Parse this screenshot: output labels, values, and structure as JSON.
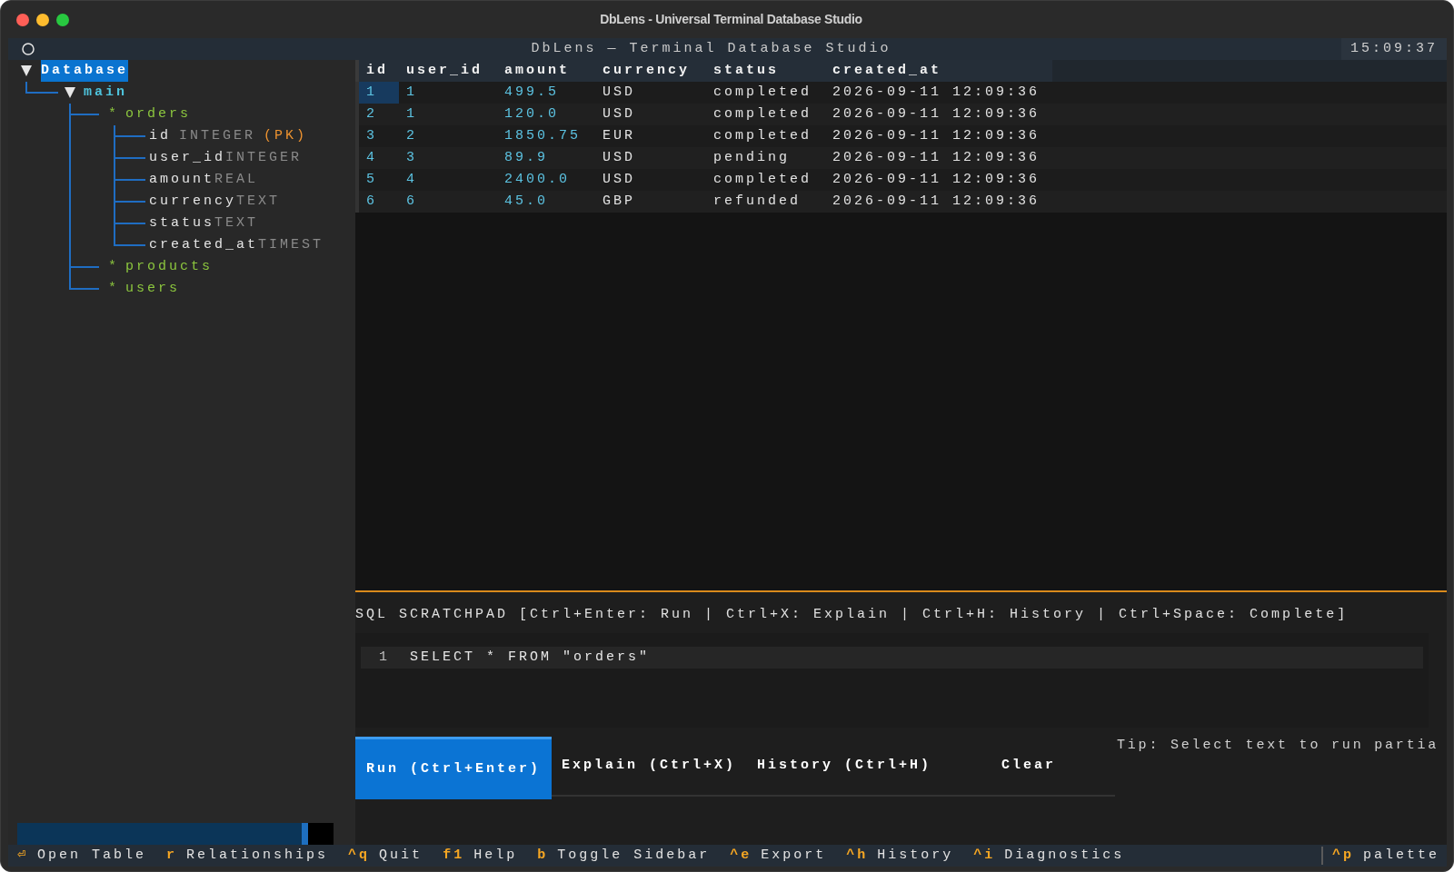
{
  "window": {
    "title": "DbLens - Universal Terminal Database Studio"
  },
  "header": {
    "title": "DbLens — Terminal Database Studio",
    "clock": "15:09:37"
  },
  "sidebar": {
    "tree": [
      {
        "kind": "database",
        "label": "Database",
        "expanded": true,
        "selected": true,
        "children": [
          {
            "kind": "schema",
            "label": "main",
            "expanded": true,
            "selected": false,
            "children": [
              {
                "kind": "table",
                "marker": "*",
                "label": "orders",
                "selected": false,
                "children": [
                  {
                    "kind": "column",
                    "label": "id",
                    "type": "INTEGER",
                    "badge": "(PK)",
                    "selected": false
                  },
                  {
                    "kind": "column",
                    "label": "user_id",
                    "type": "INTEGER",
                    "selected": false
                  },
                  {
                    "kind": "column",
                    "label": "amount",
                    "type": "REAL",
                    "selected": false
                  },
                  {
                    "kind": "column",
                    "label": "currency",
                    "type": "TEXT",
                    "selected": false
                  },
                  {
                    "kind": "column",
                    "label": "status",
                    "type": "TEXT",
                    "selected": false
                  },
                  {
                    "kind": "column",
                    "label": "created_at",
                    "type": "TIMEST",
                    "selected": false
                  }
                ]
              },
              {
                "kind": "table",
                "marker": "*",
                "label": "products",
                "selected": false
              },
              {
                "kind": "table",
                "marker": "*",
                "label": "users",
                "selected": false
              }
            ]
          }
        ]
      }
    ]
  },
  "table": {
    "columns": [
      {
        "label": "id",
        "kind": "number"
      },
      {
        "label": "user_id",
        "kind": "number"
      },
      {
        "label": "amount",
        "kind": "number"
      },
      {
        "label": "currency",
        "kind": "text"
      },
      {
        "label": "status",
        "kind": "text"
      },
      {
        "label": "created_at",
        "kind": "text"
      }
    ],
    "rows": [
      {
        "selected": true,
        "cells": [
          "1",
          "1",
          "499.5",
          "USD",
          "completed",
          "2026-09-11 12:09:36"
        ]
      },
      {
        "selected": false,
        "cells": [
          "2",
          "1",
          "120.0",
          "USD",
          "completed",
          "2026-09-11 12:09:36"
        ]
      },
      {
        "selected": false,
        "cells": [
          "3",
          "2",
          "1850.75",
          "EUR",
          "completed",
          "2026-09-11 12:09:36"
        ]
      },
      {
        "selected": false,
        "cells": [
          "4",
          "3",
          "89.9",
          "USD",
          "pending",
          "2026-09-11 12:09:36"
        ]
      },
      {
        "selected": false,
        "cells": [
          "5",
          "4",
          "2400.0",
          "USD",
          "completed",
          "2026-09-11 12:09:36"
        ]
      },
      {
        "selected": false,
        "cells": [
          "6",
          "6",
          "45.0",
          "GBP",
          "refunded",
          "2026-09-11 12:09:36"
        ]
      }
    ]
  },
  "scratchpad": {
    "title": "SQL SCRATCHPAD [Ctrl+Enter: Run | Ctrl+X: Explain | Ctrl+H: History | Ctrl+Space: Complete]",
    "lines": [
      {
        "number": "1",
        "code": "SELECT * FROM \"orders\""
      }
    ],
    "buttons": [
      {
        "label": "Run (Ctrl+Enter)",
        "focused": true
      },
      {
        "label": "Explain (Ctrl+X)",
        "focused": false
      },
      {
        "label": "History (Ctrl+H)",
        "focused": false
      },
      {
        "label": "Clear",
        "focused": false
      }
    ],
    "tip": "Tip: Select text to run partia"
  },
  "footer": {
    "shortcuts": [
      {
        "key": "⏎",
        "label": "Open Table"
      },
      {
        "key": "r",
        "label": "Relationships"
      },
      {
        "key": "^q",
        "label": "Quit"
      },
      {
        "key": "f1",
        "label": "Help"
      },
      {
        "key": "b",
        "label": "Toggle Sidebar"
      },
      {
        "key": "^e",
        "label": "Export"
      },
      {
        "key": "^h",
        "label": "History"
      },
      {
        "key": "^i",
        "label": "Diagnostics"
      }
    ],
    "palette": {
      "key": "^p",
      "label": "palette"
    }
  }
}
